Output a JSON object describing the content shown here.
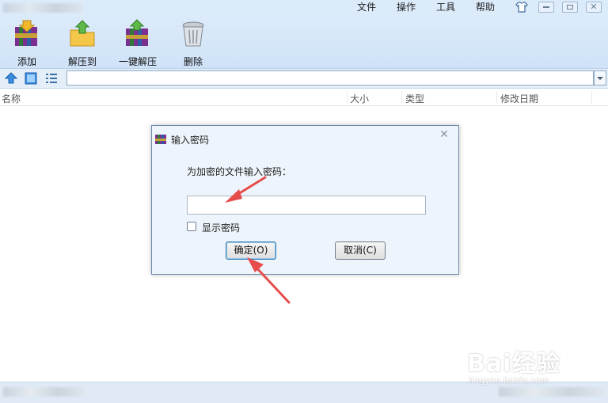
{
  "menu": [
    "文件",
    "操作",
    "工具",
    "帮助"
  ],
  "toolbar": {
    "buttons": [
      {
        "label": "添加",
        "icon": "archive-add-icon"
      },
      {
        "label": "解压到",
        "icon": "extract-folder-icon"
      },
      {
        "label": "一键解压",
        "icon": "one-click-extract-icon"
      },
      {
        "label": "删除",
        "icon": "trash-icon"
      }
    ]
  },
  "columns": [
    "名称",
    "大小",
    "类型",
    "修改日期"
  ],
  "dialog": {
    "title": "输入密码",
    "prompt": "为加密的文件输入密码：",
    "password_value": "",
    "show_password_label": "显示密码",
    "show_password_checked": false,
    "ok_label": "确定(O)",
    "cancel_label": "取消(C)"
  },
  "watermark": {
    "brand": "Bai经验",
    "url": "jingyan.baidu.com"
  },
  "colors": {
    "toolbar_bg": "#dcebfa",
    "dialog_bg": "#eef4fb",
    "arrow": "#e74c4c",
    "accent": "#3c7fb1"
  }
}
